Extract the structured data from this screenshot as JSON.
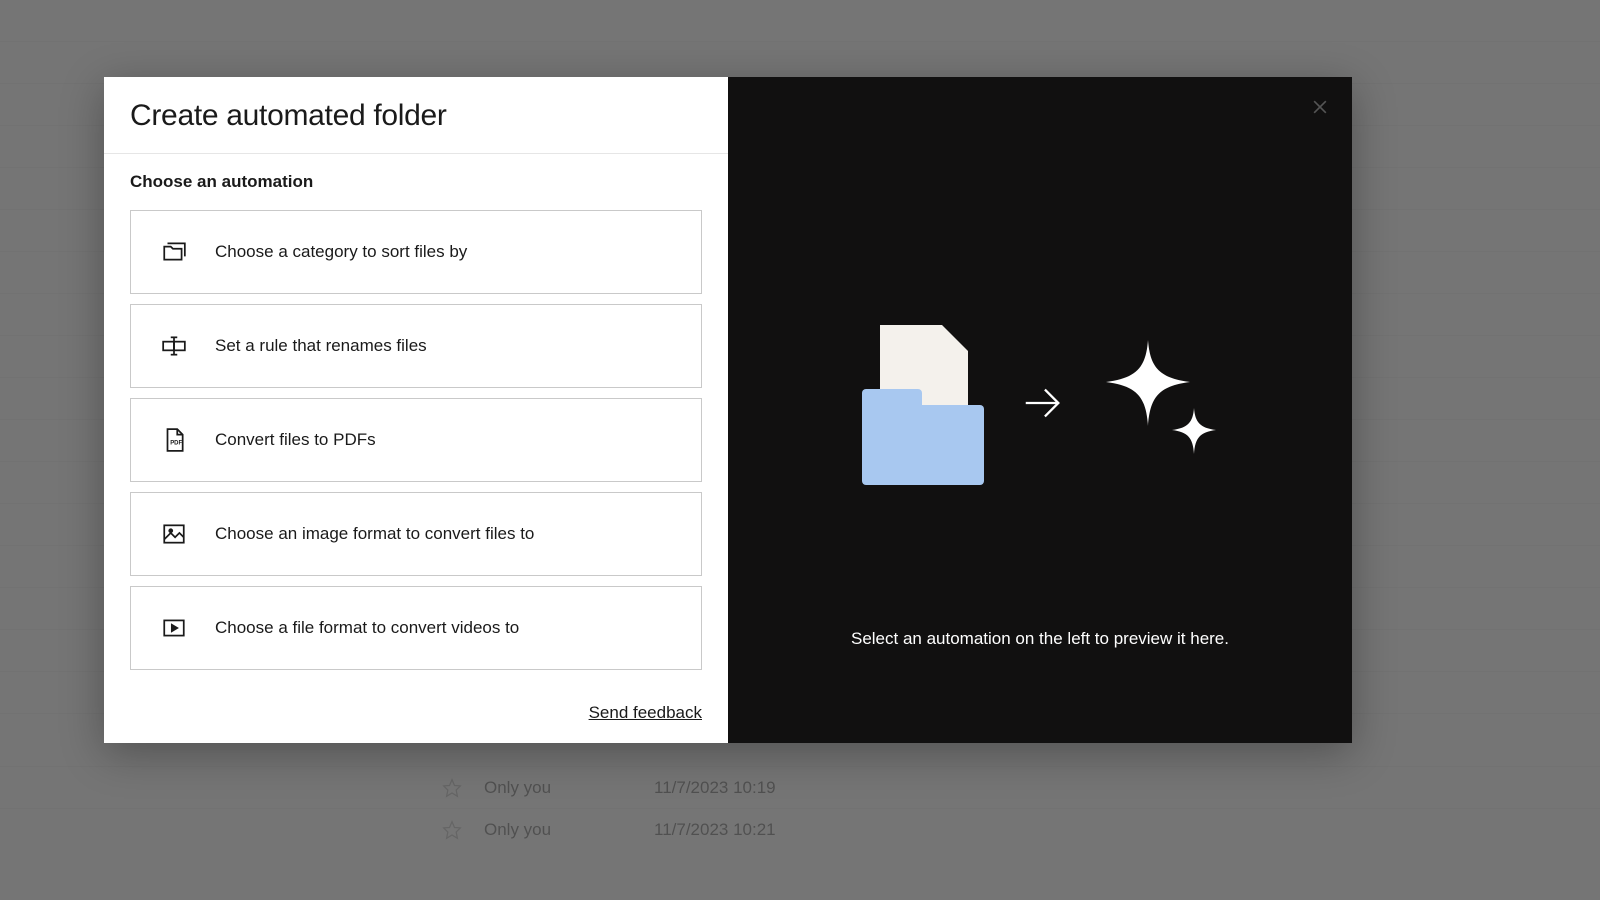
{
  "modal": {
    "title": "Create automated folder",
    "section_label": "Choose an automation",
    "options": [
      {
        "label": "Choose a category to sort files by"
      },
      {
        "label": "Set a rule that renames files"
      },
      {
        "label": "Convert files to PDFs"
      },
      {
        "label": "Choose an image format to convert files to"
      },
      {
        "label": "Choose a file format to convert videos to"
      }
    ],
    "feedback_link": "Send feedback",
    "preview_text": "Select an automation on the left to preview it here."
  },
  "background_rows": [
    {
      "who": "Only you",
      "date": "11/7/2023 10:19"
    },
    {
      "who": "Only you",
      "date": "11/7/2023 10:21"
    }
  ]
}
